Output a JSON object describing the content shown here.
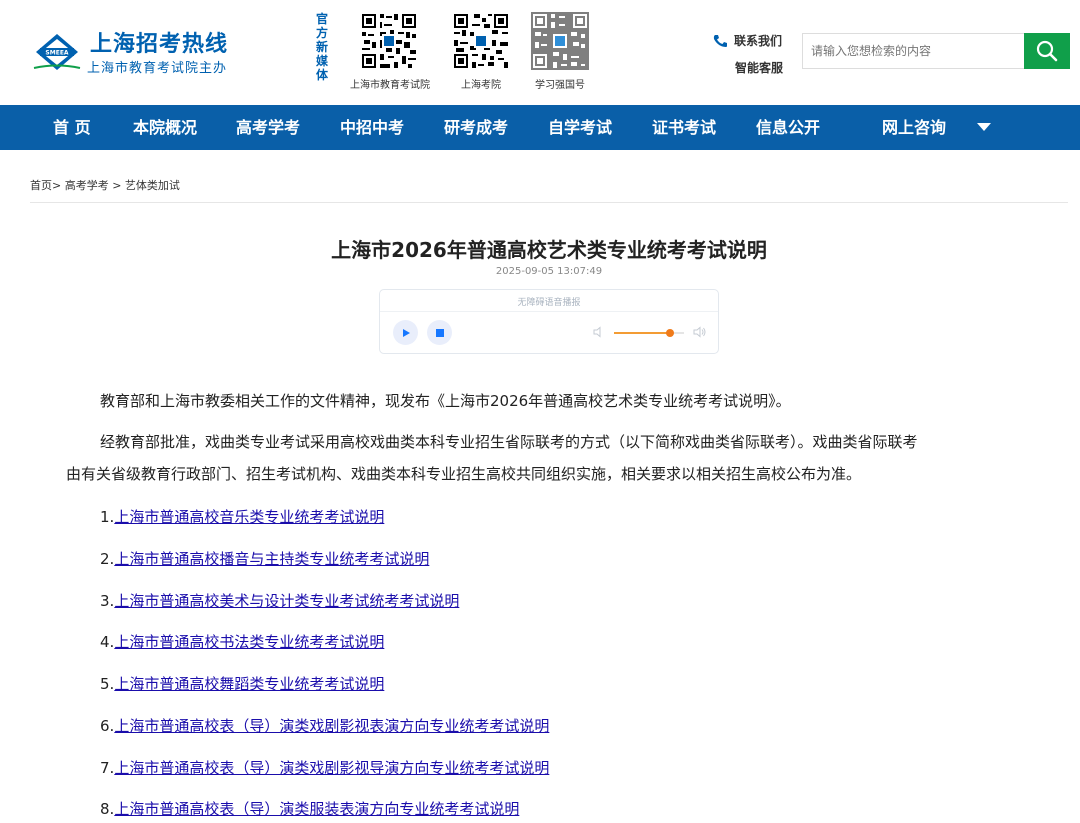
{
  "header": {
    "logo_title": "上海招考热线",
    "logo_subtitle": "上海市教育考试院主办",
    "logo_mark_text": "SMEEA",
    "media_label": [
      "官",
      "方",
      "新",
      "媒",
      "体"
    ],
    "qr_codes": [
      {
        "caption": "上海市教育考试院"
      },
      {
        "caption": "上海考院"
      },
      {
        "caption": "学习强国号"
      }
    ],
    "contact_label": "联系我们",
    "service_label": "智能客服",
    "search_placeholder": "请输入您想检索的内容"
  },
  "nav": {
    "items": [
      "首 页",
      "本院概况",
      "高考学考",
      "中招中考",
      "研考成考",
      "自学考试",
      "证书考试",
      "信息公开",
      "网上咨询"
    ]
  },
  "breadcrumb": "首页> 高考学考 > 艺体类加试",
  "article": {
    "title": "上海市2026年普通高校艺术类专业统考考试说明",
    "date": "2025-09-05 13:07:49",
    "player_label": "无障碍语音播报",
    "volume_level": 0.8,
    "paragraph1": "教育部和上海市教委相关工作的文件精神，现发布《上海市2026年普通高校艺术类专业统考考试说明》。",
    "paragraph2_line1": "经教育部批准，戏曲类专业考试采用高校戏曲类本科专业招生省际联考的方式（以下简称戏曲类省际联考）。戏曲类省际联考",
    "paragraph2_line2": "由有关省级教育行政部门、招生考试机构、戏曲类本科专业招生高校共同组织实施，相关要求以相关招生高校公布为准。",
    "links": [
      {
        "num": "1.",
        "text": "上海市普通高校音乐类专业统考考试说明"
      },
      {
        "num": "2.",
        "text": "上海市普通高校播音与主持类专业统考考试说明"
      },
      {
        "num": "3.",
        "text": "上海市普通高校美术与设计类专业考试统考考试说明"
      },
      {
        "num": "4.",
        "text": "上海市普通高校书法类专业统考考试说明"
      },
      {
        "num": "5.",
        "text": "上海市普通高校舞蹈类专业统考考试说明"
      },
      {
        "num": "6.",
        "text": "上海市普通高校表（导）演类戏剧影视表演方向专业统考考试说明"
      },
      {
        "num": "7.",
        "text": "上海市普通高校表（导）演类戏剧影视导演方向专业统考考试说明"
      },
      {
        "num": "8.",
        "text": "上海市普通高校表（导）演类服装表演方向专业统考考试说明"
      }
    ]
  },
  "colors": {
    "brand_blue": "#0a5fa8",
    "search_green": "#109f4a",
    "link": "#1a0dab"
  }
}
